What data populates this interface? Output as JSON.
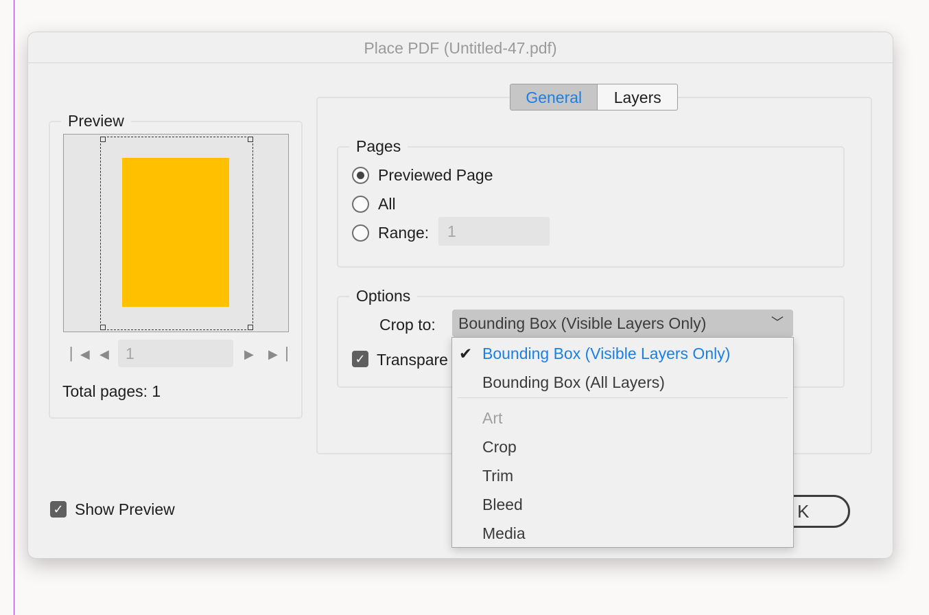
{
  "dialog": {
    "title": "Place PDF (Untitled-47.pdf)"
  },
  "preview": {
    "legend": "Preview",
    "page_field_value": "1",
    "total_pages_label": "Total pages: 1",
    "nav_icons": [
      "first-page-icon",
      "prev-page-icon",
      "next-page-icon",
      "last-page-icon"
    ]
  },
  "tabs": [
    {
      "label": "General",
      "active": true
    },
    {
      "label": "Layers",
      "active": false
    }
  ],
  "pages": {
    "legend": "Pages",
    "options": [
      {
        "label": "Previewed Page",
        "selected": true
      },
      {
        "label": "All",
        "selected": false
      },
      {
        "label": "Range:",
        "selected": false
      }
    ],
    "range_value": "1"
  },
  "options": {
    "legend": "Options",
    "crop_label": "Crop to:",
    "crop_value": "Bounding Box (Visible Layers Only)",
    "transparent_label": "Transpare",
    "transparent_checked": true
  },
  "crop_menu": {
    "items": [
      {
        "label": "Bounding Box (Visible Layers Only)",
        "selected": true,
        "enabled": true
      },
      {
        "label": "Bounding Box (All Layers)",
        "selected": false,
        "enabled": true
      },
      {
        "label": "Art",
        "selected": false,
        "enabled": false
      },
      {
        "label": "Crop",
        "selected": false,
        "enabled": true
      },
      {
        "label": "Trim",
        "selected": false,
        "enabled": true
      },
      {
        "label": "Bleed",
        "selected": false,
        "enabled": true
      },
      {
        "label": "Media",
        "selected": false,
        "enabled": true
      }
    ]
  },
  "footer": {
    "show_preview_label": "Show Preview",
    "show_preview_checked": true,
    "ok_button_partial": "K"
  },
  "colors": {
    "accent": "#1a80e6",
    "preview_page": "#ffc000"
  }
}
